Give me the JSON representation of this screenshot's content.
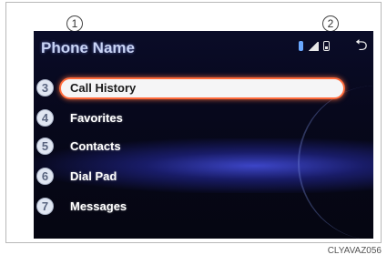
{
  "header": {
    "title": "Phone Name",
    "status_icons": [
      "bluetooth-icon",
      "signal-strength-icon",
      "battery-icon"
    ],
    "back_icon": "back-icon"
  },
  "menu": {
    "items": [
      {
        "number": "3",
        "label": "Call History",
        "selected": true
      },
      {
        "number": "4",
        "label": "Favorites",
        "selected": false
      },
      {
        "number": "5",
        "label": "Contacts",
        "selected": false
      },
      {
        "number": "6",
        "label": "Dial Pad",
        "selected": false
      },
      {
        "number": "7",
        "label": "Messages",
        "selected": false
      }
    ]
  },
  "callouts": {
    "title": "1",
    "status": "2"
  },
  "caption": "CLYAVAZ056",
  "colors": {
    "selection_border": "#ff6a3a",
    "screen_bg": "#07081c",
    "title_text": "#c8d3f4"
  }
}
